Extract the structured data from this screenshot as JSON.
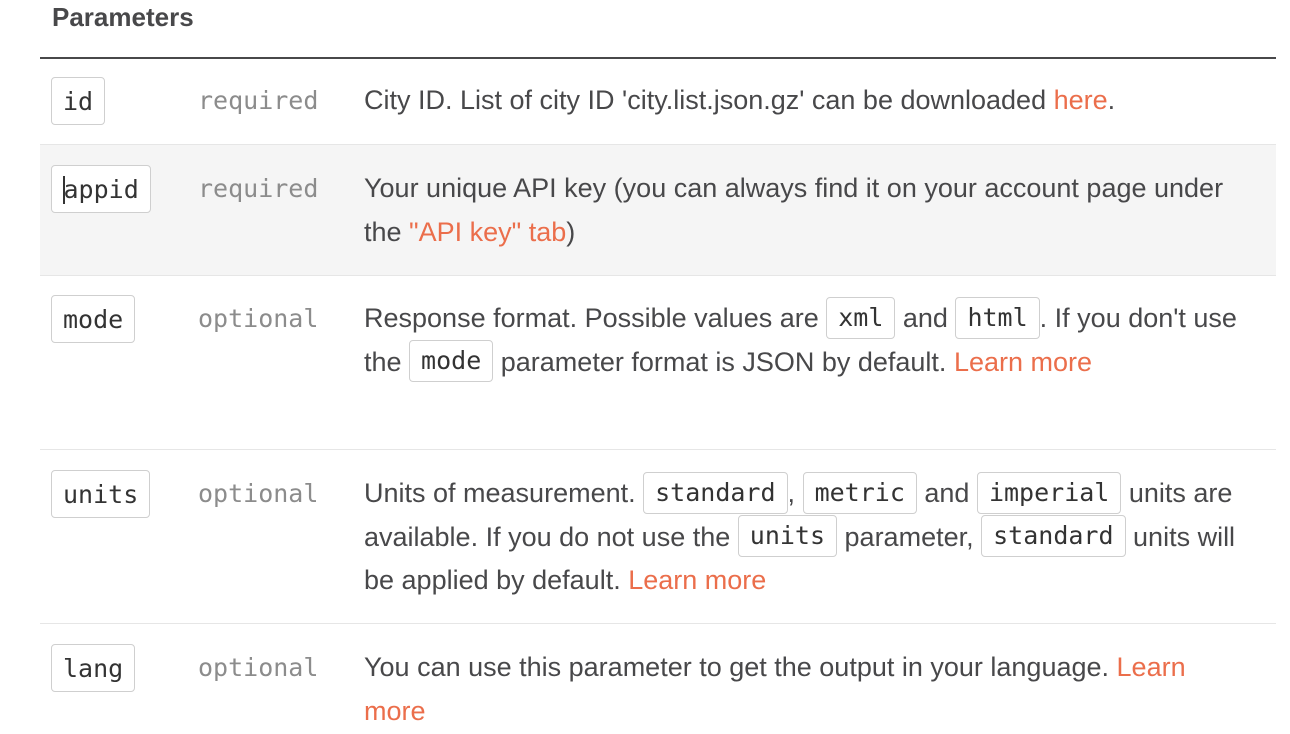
{
  "heading": "Parameters",
  "rows": [
    {
      "name": "id",
      "requirement": "required",
      "desc": {
        "t1": "City ID. List of city ID 'city.list.json.gz' can be downloaded ",
        "link": "here",
        "t2": "."
      }
    },
    {
      "name": "appid",
      "requirement": "required",
      "desc": {
        "t1": "Your unique API key (you can always find it on your account page under the ",
        "link": "\"API key\" tab",
        "t2": ")"
      }
    },
    {
      "name": "mode",
      "requirement": "optional",
      "desc": {
        "t1": "Response format. Possible values are ",
        "c1": "xml",
        "t2": " and ",
        "c2": "html",
        "t3": ". If you don't use the ",
        "c3": "mode",
        "t4": " parameter format is JSON by default. ",
        "link": "Learn more"
      }
    },
    {
      "name": "units",
      "requirement": "optional",
      "desc": {
        "t1": "Units of measurement. ",
        "c1": "standard",
        "t2": ", ",
        "c2": "metric",
        "t3": " and ",
        "c3": "imperial",
        "t4": " units are available. If you do not use the ",
        "c4": "units",
        "t5": " parameter, ",
        "c5": "standard",
        "t6": " units will be applied by default. ",
        "link": "Learn more"
      }
    },
    {
      "name": "lang",
      "requirement": "optional",
      "desc": {
        "t1": "You can use this parameter to get the output in your language. ",
        "link": "Learn more"
      }
    }
  ],
  "colors": {
    "text": "#48484a",
    "link": "#eb6e4b",
    "muted": "#8c8c8c",
    "row_shade": "#f5f5f5"
  }
}
